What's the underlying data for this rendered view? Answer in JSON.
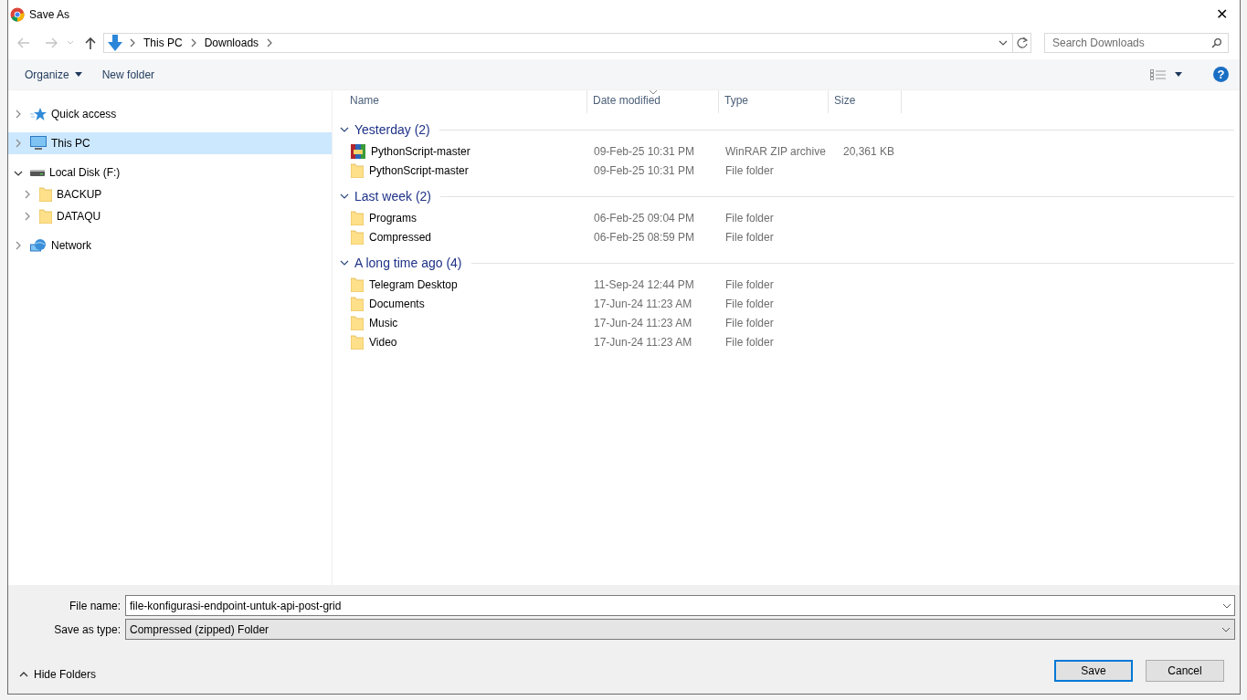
{
  "window": {
    "title": "Save As",
    "close": "✕"
  },
  "address": {
    "path": [
      "This PC",
      "Downloads"
    ]
  },
  "search": {
    "placeholder": "Search Downloads"
  },
  "toolbar": {
    "organize": "Organize",
    "new_folder": "New folder",
    "help": "?"
  },
  "sidebar": {
    "items": [
      {
        "label": "Quick access",
        "kind": "star",
        "expanded": false,
        "selected": false
      },
      {
        "label": "This PC",
        "kind": "pc",
        "expanded": false,
        "selected": true
      },
      {
        "label": "Local Disk (F:)",
        "kind": "disk",
        "expanded": true,
        "selected": false,
        "children": [
          {
            "label": "BACKUP",
            "kind": "folder",
            "expanded": false,
            "selected": false
          },
          {
            "label": "DATAQU",
            "kind": "folder",
            "expanded": false,
            "selected": false
          }
        ]
      },
      {
        "label": "Network",
        "kind": "network",
        "expanded": false,
        "selected": false
      }
    ]
  },
  "table": {
    "columns": [
      {
        "label": "Name",
        "sorted": false
      },
      {
        "label": "Date modified",
        "sorted": true
      },
      {
        "label": "Type",
        "sorted": false
      },
      {
        "label": "Size",
        "sorted": false
      }
    ],
    "groups": [
      {
        "label": "Yesterday (2)",
        "expanded": true,
        "rows": [
          {
            "kind": "archive",
            "name": "PythonScript-master",
            "date": "09-Feb-25 10:31 PM",
            "type": "WinRAR ZIP archive",
            "size": "20,361 KB"
          },
          {
            "kind": "folder",
            "name": "PythonScript-master",
            "date": "09-Feb-25 10:31 PM",
            "type": "File folder"
          }
        ]
      },
      {
        "label": "Last week (2)",
        "expanded": true,
        "rows": [
          {
            "kind": "folder",
            "name": "Programs",
            "date": "06-Feb-25 09:04 PM",
            "type": "File folder"
          },
          {
            "kind": "folder",
            "name": "Compressed",
            "date": "06-Feb-25 08:59 PM",
            "type": "File folder"
          }
        ]
      },
      {
        "label": "A long time ago (4)",
        "expanded": true,
        "rows": [
          {
            "kind": "folder",
            "name": "Telegram Desktop",
            "date": "11-Sep-24 12:44 PM",
            "type": "File folder"
          },
          {
            "kind": "folder",
            "name": "Documents",
            "date": "17-Jun-24 11:23 AM",
            "type": "File folder"
          },
          {
            "kind": "folder",
            "name": "Music",
            "date": "17-Jun-24 11:23 AM",
            "type": "File folder"
          },
          {
            "kind": "folder",
            "name": "Video",
            "date": "17-Jun-24 11:23 AM",
            "type": "File folder"
          }
        ]
      }
    ]
  },
  "form": {
    "file_name_label": "File name:",
    "file_name": "file-konfigurasi-endpoint-untuk-api-post-grid",
    "type_label": "Save as type:",
    "type_value": "Compressed (zipped) Folder"
  },
  "hide_folders": "Hide Folders",
  "buttons": [
    {
      "label": "Save",
      "default": true
    },
    {
      "label": "Cancel",
      "default": false
    }
  ]
}
